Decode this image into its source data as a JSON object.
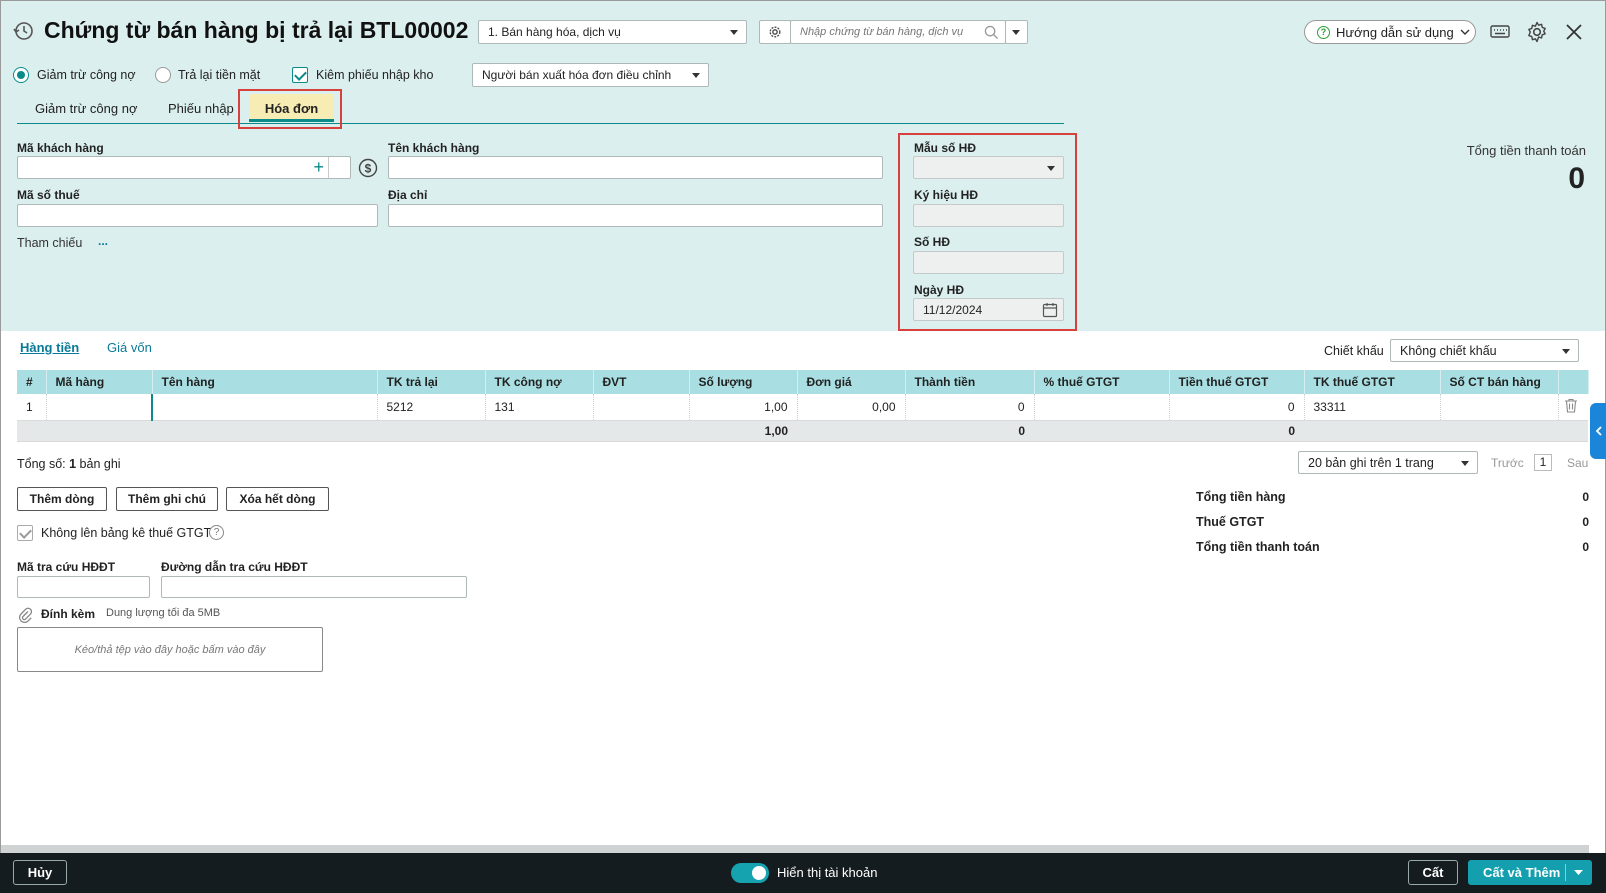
{
  "header": {
    "title": "Chứng từ bán hàng bị trả lại BTL00002",
    "type_select": "1. Bán hàng hóa, dịch vụ",
    "search_placeholder": "Nhập chứng từ bán hàng, dịch vụ",
    "help_label": "Hướng dẫn sử dụng"
  },
  "options": {
    "radio_reduce_debt": "Giảm trừ công nợ",
    "radio_refund_cash": "Trả lại tiền mặt",
    "check_import_slip": "Kiêm phiếu nhập kho",
    "invoice_type_select": "Người bán xuất hóa đơn điều chỉnh"
  },
  "tabs": [
    "Giảm trừ công nợ",
    "Phiếu nhập",
    "Hóa đơn"
  ],
  "form": {
    "customer_code_label": "Mã khách hàng",
    "customer_name_label": "Tên khách hàng",
    "tax_code_label": "Mã số thuế",
    "address_label": "Địa chỉ",
    "reference_label": "Tham chiếu",
    "reference_more": "...",
    "invoice_template_label": "Mẫu số HĐ",
    "invoice_symbol_label": "Ký hiệu HĐ",
    "invoice_number_label": "Số HĐ",
    "invoice_date_label": "Ngày HĐ",
    "invoice_date_value": "11/12/2024",
    "total_payment_label": "Tổng tiền thanh toán",
    "total_payment_value": "0"
  },
  "detail_tabs": [
    "Hàng tiền",
    "Giá vốn"
  ],
  "discount": {
    "label": "Chiết khấu",
    "value": "Không chiết khấu"
  },
  "table": {
    "columns": [
      "#",
      "Mã hàng",
      "Tên hàng",
      "TK trả lại",
      "TK công nợ",
      "ĐVT",
      "Số lượng",
      "Đơn giá",
      "Thành tiền",
      "% thuế GTGT",
      "Tiền thuế GTGT",
      "TK thuế GTGT",
      "Số CT bán hàng"
    ],
    "rows": [
      [
        "1",
        "",
        "",
        "5212",
        "131",
        "",
        "1,00",
        "0,00",
        "0",
        "",
        "0",
        "33311",
        ""
      ]
    ],
    "summary": {
      "quantity": "1,00",
      "amount": "0",
      "tax": "0"
    }
  },
  "pagination": {
    "record_prefix": "Tổng số: ",
    "record_count": "1",
    "record_suffix": " bản ghi",
    "page_size": "20 bản ghi trên 1 trang",
    "prev": "Trước",
    "page": "1",
    "next": "Sau"
  },
  "actions": {
    "add_row": "Thêm dòng",
    "add_note": "Thêm ghi chú",
    "delete_rows": "Xóa hết dòng"
  },
  "vat_checkbox": "Không lên bảng kê thuế GTGT",
  "einvoice": {
    "lookup_code_label": "Mã tra cứu HĐĐT",
    "lookup_url_label": "Đường dẫn tra cứu HĐĐT"
  },
  "attachment": {
    "label": "Đính kèm",
    "hint": "Dung lượng tối đa 5MB",
    "drop_text": "Kéo/thả tệp vào đây hoặc bấm vào đây"
  },
  "totals": {
    "goods_label": "Tổng tiền hàng",
    "goods_value": "0",
    "vat_label": "Thuế GTGT",
    "vat_value": "0",
    "payment_label": "Tổng tiền thanh toán",
    "payment_value": "0"
  },
  "footer": {
    "cancel": "Hủy",
    "show_accounts": "Hiển thị tài khoản",
    "save": "Cất",
    "save_add": "Cất và Thêm"
  },
  "colors": {
    "header_bg": "#dcefef",
    "accent": "#0b8a8a",
    "table_header": "#a9dfe3",
    "highlight": "#d8403d",
    "footer_bg": "#151c1f",
    "primary_button": "#139fae"
  }
}
